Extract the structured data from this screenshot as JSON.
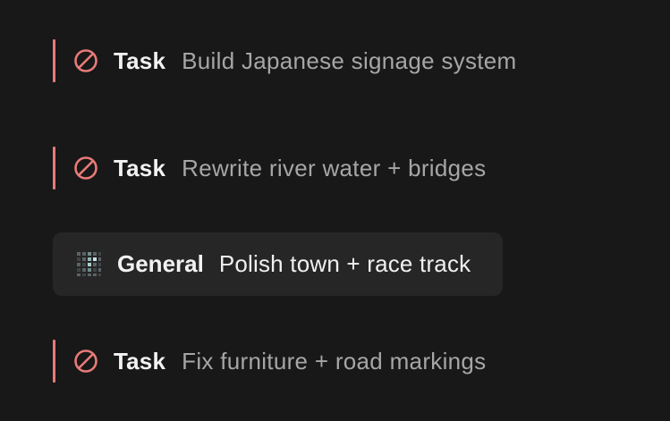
{
  "items": [
    {
      "kind": "Task",
      "title": "Build Japanese signage system",
      "icon": "blocked-icon",
      "accent": "#e87b78"
    },
    {
      "kind": "Task",
      "title": "Rewrite river water + bridges",
      "icon": "blocked-icon",
      "accent": "#e87b78"
    },
    {
      "kind": "General",
      "title": "Polish town + race track",
      "icon": "pixel-grid-icon",
      "selected": true
    },
    {
      "kind": "Task",
      "title": "Fix furniture + road markings",
      "icon": "blocked-icon",
      "accent": "#e87b78"
    }
  ]
}
